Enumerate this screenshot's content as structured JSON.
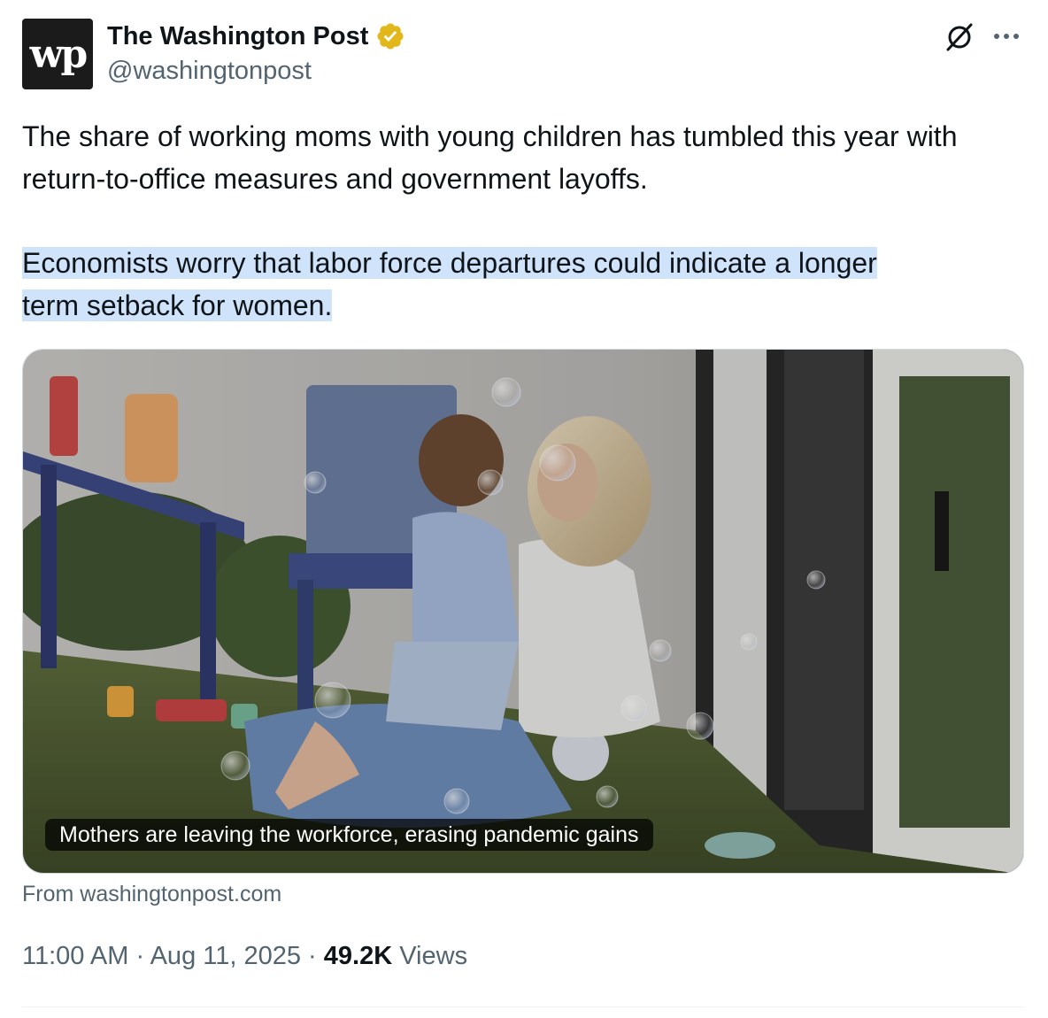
{
  "account": {
    "avatar_text": "wp",
    "display_name": "The Washington Post",
    "handle": "@washingtonpost",
    "verified_color": "#e2b719"
  },
  "tweet": {
    "paragraph_1": "The share of working moms with young children has tumbled this year with return-to-office measures and government layoffs.",
    "paragraph_2_line_1": "Economists worry that labor force departures could indicate a longer",
    "paragraph_2_line_2": "term setback for women."
  },
  "card": {
    "caption": "Mothers are leaving the workforce, erasing pandemic gains",
    "source": "From washingtonpost.com"
  },
  "meta": {
    "time": "11:00 AM",
    "separator": "·",
    "date": "Aug 11, 2025",
    "views_count": "49.2K",
    "views_label": "Views"
  },
  "icons": {
    "grok": "grok-icon",
    "more": "more-icon",
    "verified": "verified-badge-icon"
  },
  "colors": {
    "text_primary": "#0f1419",
    "text_secondary": "#536471",
    "selection": "#cfe3fb"
  }
}
